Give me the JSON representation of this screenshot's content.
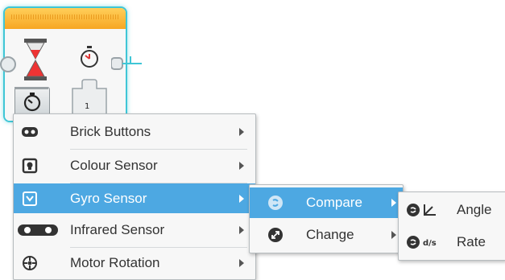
{
  "block": {
    "port_value": "1",
    "icons": [
      "hourglass-icon",
      "timer-icon",
      "mode-timer-icon"
    ],
    "colors": {
      "header": "#f7a623",
      "selection_outline": "#3fc6d6"
    }
  },
  "menu_main": {
    "items": [
      {
        "label": "Brick Buttons",
        "icon": "brick-buttons-icon",
        "has_submenu": true,
        "selected": false
      },
      {
        "label": "Colour Sensor",
        "icon": "colour-sensor-icon",
        "has_submenu": true,
        "selected": false
      },
      {
        "label": "Gyro Sensor",
        "icon": "gyro-sensor-icon",
        "has_submenu": true,
        "selected": true
      },
      {
        "label": "Infrared Sensor",
        "icon": "infrared-sensor-icon",
        "has_submenu": true,
        "selected": false
      },
      {
        "label": "Motor Rotation",
        "icon": "motor-rotation-icon",
        "has_submenu": true,
        "selected": false
      }
    ]
  },
  "menu_gyro": {
    "items": [
      {
        "label": "Compare",
        "icon": "compare-icon",
        "has_submenu": true,
        "selected": true
      },
      {
        "label": "Change",
        "icon": "change-icon",
        "has_submenu": true,
        "selected": false
      }
    ]
  },
  "menu_compare": {
    "items": [
      {
        "label": "Angle",
        "icon": "angle-icon"
      },
      {
        "label": "Rate",
        "icon": "rate-icon"
      }
    ]
  },
  "colors": {
    "menu_selected": "#4da8e2",
    "menu_bg": "#f7f7f7"
  }
}
